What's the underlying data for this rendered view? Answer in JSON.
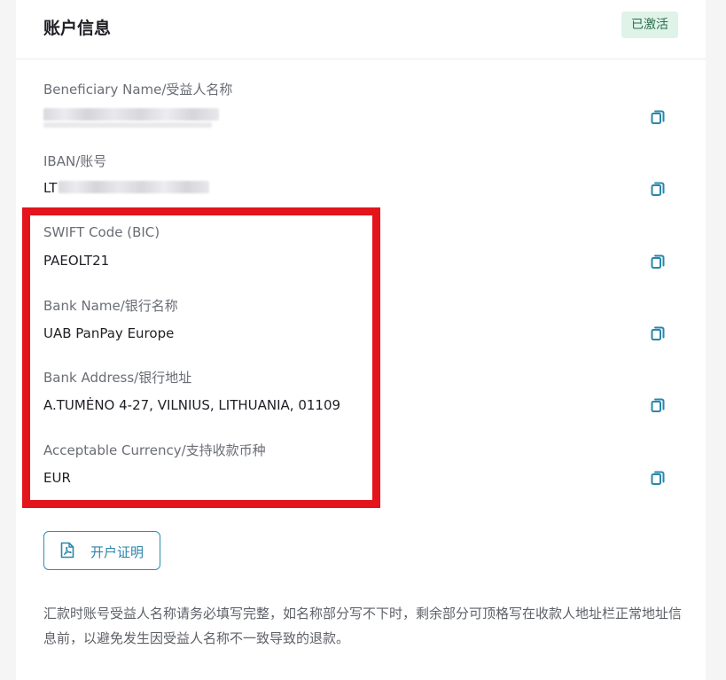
{
  "header": {
    "title": "账户信息",
    "status_badge": "已激活"
  },
  "fields": [
    {
      "label": "Beneficiary Name/受益人名称",
      "value": ""
    },
    {
      "label": "IBAN/账号",
      "value": "LT"
    },
    {
      "label": "SWIFT Code (BIC)",
      "value": "PAEOLT21"
    },
    {
      "label": "Bank Name/银行名称",
      "value": "UAB PanPay Europe"
    },
    {
      "label": "Bank Address/银行地址",
      "value": "A.TUMĖNO 4-27, VILNIUS, LITHUANIA, 01109"
    },
    {
      "label": "Acceptable Currency/支持收款币种",
      "value": "EUR"
    }
  ],
  "certificate_button": {
    "label": "开户证明",
    "icon": "pdf-icon"
  },
  "note": "汇款时账号受益人名称请务必填写完整，如名称部分写不下时，剩余部分可顶格写在收款人地址栏正常地址信息前，以避免发生因受益人名称不一致导致的退款。",
  "colors": {
    "accent": "#2a86aa",
    "highlight": "#e3141b",
    "badge_bg": "#dff3e8"
  }
}
